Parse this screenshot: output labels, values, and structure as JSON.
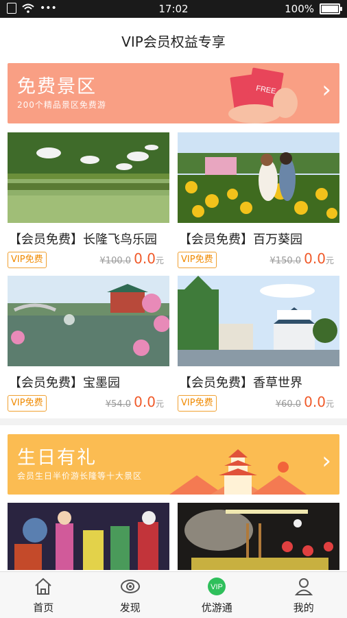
{
  "status_bar": {
    "time": "17:02",
    "battery": "100%",
    "dots": "•••"
  },
  "header": {
    "title": "VIP会员权益专享"
  },
  "section_free": {
    "banner_title": "免费景区",
    "banner_subtitle": "200个精品景区免费游",
    "banner_tag": "FREE"
  },
  "cards": [
    {
      "name": "【会员免费】长隆飞鸟乐园",
      "badge": "VIP免费",
      "old_price": "¥100.0",
      "price": "0.0",
      "unit": "元"
    },
    {
      "name": "【会员免费】百万葵园",
      "badge": "VIP免费",
      "old_price": "¥150.0",
      "price": "0.0",
      "unit": "元"
    },
    {
      "name": "【会员免费】宝墨园",
      "badge": "VIP免费",
      "old_price": "¥54.0",
      "price": "0.0",
      "unit": "元"
    },
    {
      "name": "【会员免费】香草世界",
      "badge": "VIP免费",
      "old_price": "¥60.0",
      "price": "0.0",
      "unit": "元"
    }
  ],
  "section_birthday": {
    "banner_title": "生日有礼",
    "banner_subtitle": "会员生日半价游长隆等十大景区"
  },
  "tabs": [
    {
      "label": "首页",
      "icon": "home-icon"
    },
    {
      "label": "发现",
      "icon": "eye-icon"
    },
    {
      "label": "优游通",
      "icon": "vip-icon",
      "icon_text": "VIP"
    },
    {
      "label": "我的",
      "icon": "user-icon"
    }
  ],
  "colors": {
    "price": "#f05a2a",
    "badge": "#f08a00",
    "banner_free": "#f99f84",
    "banner_birthday": "#fbbc52",
    "vip_green": "#2fbf5b"
  }
}
